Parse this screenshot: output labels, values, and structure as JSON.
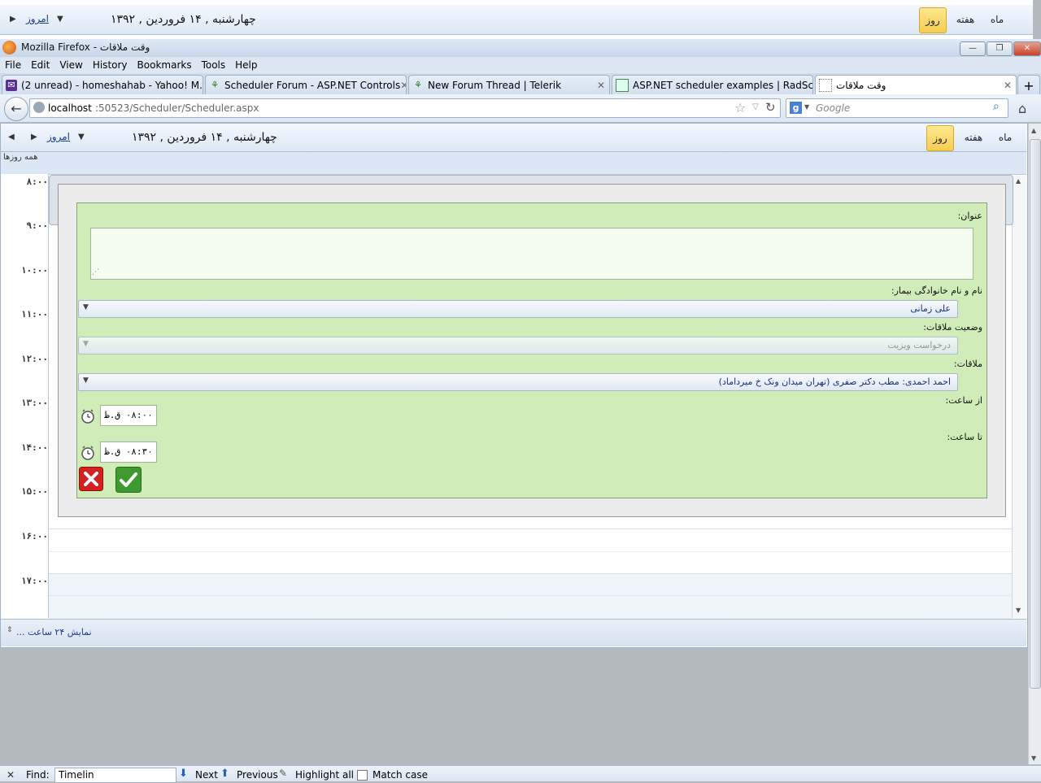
{
  "background_scheduler": {
    "date": "چهارشنبه , ۱۴  فروردین , ۱۳۹۲",
    "today": "امروز",
    "views": [
      "ماه",
      "هفته",
      "روز"
    ]
  },
  "window": {
    "title": "وقت ملاقات - Mozilla Firefox",
    "minimize": "—",
    "maximize": "❐",
    "close": "✕"
  },
  "menu": [
    "File",
    "Edit",
    "View",
    "History",
    "Bookmarks",
    "Tools",
    "Help"
  ],
  "tabs": [
    {
      "label": "(2 unread) - homeshahab - Yahoo! M..."
    },
    {
      "label": "Scheduler Forum - ASP.NET Controls"
    },
    {
      "label": "New Forum Thread | Telerik"
    },
    {
      "label": "ASP.NET scheduler examples | RadSc..."
    },
    {
      "label": "وقت ملاقات"
    }
  ],
  "address": {
    "host": "localhost",
    "path": ":50523/Scheduler/Scheduler.aspx",
    "search_placeholder": "Google"
  },
  "scheduler": {
    "date": "چهارشنبه , ۱۴  فروردین , ۱۳۹۲",
    "today": "امروز",
    "views": {
      "month": "ماه",
      "week": "هفته",
      "day": "روز"
    },
    "all_day": "همه روزها",
    "hours": [
      "۸:۰۰",
      "۹:۰۰",
      "۱۰:۰۰",
      "۱۱:۰۰",
      "۱۲:۰۰",
      "۱۳:۰۰",
      "۱۴:۰۰",
      "۱۵:۰۰",
      "۱۶:۰۰",
      "۱۷:۰۰"
    ],
    "footer": "نمایش ۲۴ ساعت ..."
  },
  "form": {
    "title_label": "عنوان:",
    "title_value": "",
    "patient_label": "نام و نام خانوادگی بیمار:",
    "patient_value": "علی زمانی",
    "status_label": "وضعیت ملاقات:",
    "status_value": "درخواست ویزیت",
    "meeting_label": "ملاقات:",
    "meeting_value": "احمد احمدی: مطب دکتر صفری (تهران میدان ونک خ میرداماد)",
    "from_label": "از ساعت:",
    "from_value": "۰۸:۰۰ ق.ظ",
    "to_label": "تا ساعت:",
    "to_value": "۰۸:۳۰ ق.ظ"
  },
  "findbar": {
    "label": "Find:",
    "value": "Timelin",
    "next": "Next",
    "previous": "Previous",
    "highlight": "Highlight all",
    "match_case": "Match case"
  },
  "colors": {
    "form_bg": "#d0edb9",
    "active_view": "#f6cd4f",
    "cancel": "#d42020",
    "save": "#3e9a2e"
  }
}
